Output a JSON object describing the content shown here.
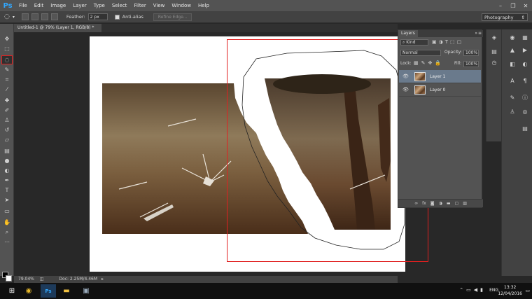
{
  "app": {
    "logo": "Ps"
  },
  "menu": [
    "File",
    "Edit",
    "Image",
    "Layer",
    "Type",
    "Select",
    "Filter",
    "View",
    "Window",
    "Help"
  ],
  "window_controls": {
    "minimize": "–",
    "maximize": "❐",
    "close": "✕"
  },
  "options": {
    "feather_label": "Feather:",
    "feather_value": "2 px",
    "antialias_label": "Anti-alias",
    "refine_label": "Refine Edge...",
    "workspace": "Photography"
  },
  "document": {
    "tab_title": "Untitled-1 @ 79% (Layer 1, RGB/8) *"
  },
  "status": {
    "zoom": "79.04%",
    "doc_size": "Doc: 2.25M/4.46M"
  },
  "layers_panel": {
    "tab": "Layers",
    "filter": "Kind",
    "blend_mode": "Normal",
    "opacity_label": "Opacity:",
    "opacity_value": "100%",
    "lock_label": "Lock:",
    "fill_label": "Fill:",
    "fill_value": "100%",
    "layers": [
      {
        "name": "Layer 1",
        "selected": true
      },
      {
        "name": "Layer 0",
        "selected": false
      }
    ],
    "footer_icons": [
      "link-icon",
      "fx-icon",
      "mask-icon",
      "adjustment-icon",
      "folder-icon",
      "new-layer-icon",
      "trash-icon"
    ]
  },
  "taskbar": {
    "time": "13:32",
    "date": "12/04/2016",
    "language": "ENG"
  },
  "colors": {
    "selection_red": "#e02020",
    "ui_dark": "#535353",
    "ps_blue": "#31a8ff"
  }
}
